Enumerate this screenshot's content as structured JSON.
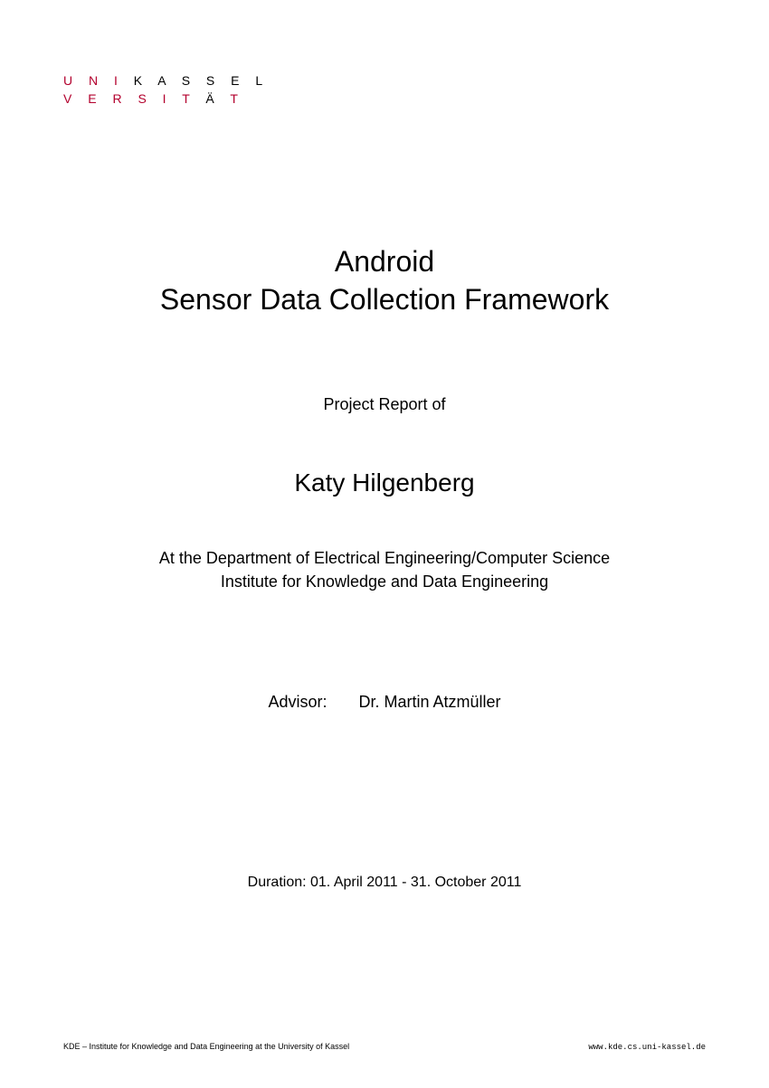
{
  "logo": {
    "line1_red": "U N I",
    "line1_black": " K A S S E L",
    "line2_red": "V E R S I T ",
    "line2_black": "A",
    "line2_red2": "̈ T"
  },
  "title_line1": "Android",
  "title_line2": "Sensor Data Collection Framework",
  "report_of": "Project Report of",
  "author": "Katy Hilgenberg",
  "department_line1": "At the Department of Electrical Engineering/Computer Science",
  "department_line2": "Institute for Knowledge and Data Engineering",
  "advisor_label": "Advisor:",
  "advisor_name": "Dr. Martin Atzmüller",
  "duration": "Duration: 01. April 2011   -   31. October 2011",
  "footer_left": "KDE – Institute for Knowledge and Data Engineering at the University of Kassel",
  "footer_right": "www.kde.cs.uni-kassel.de"
}
